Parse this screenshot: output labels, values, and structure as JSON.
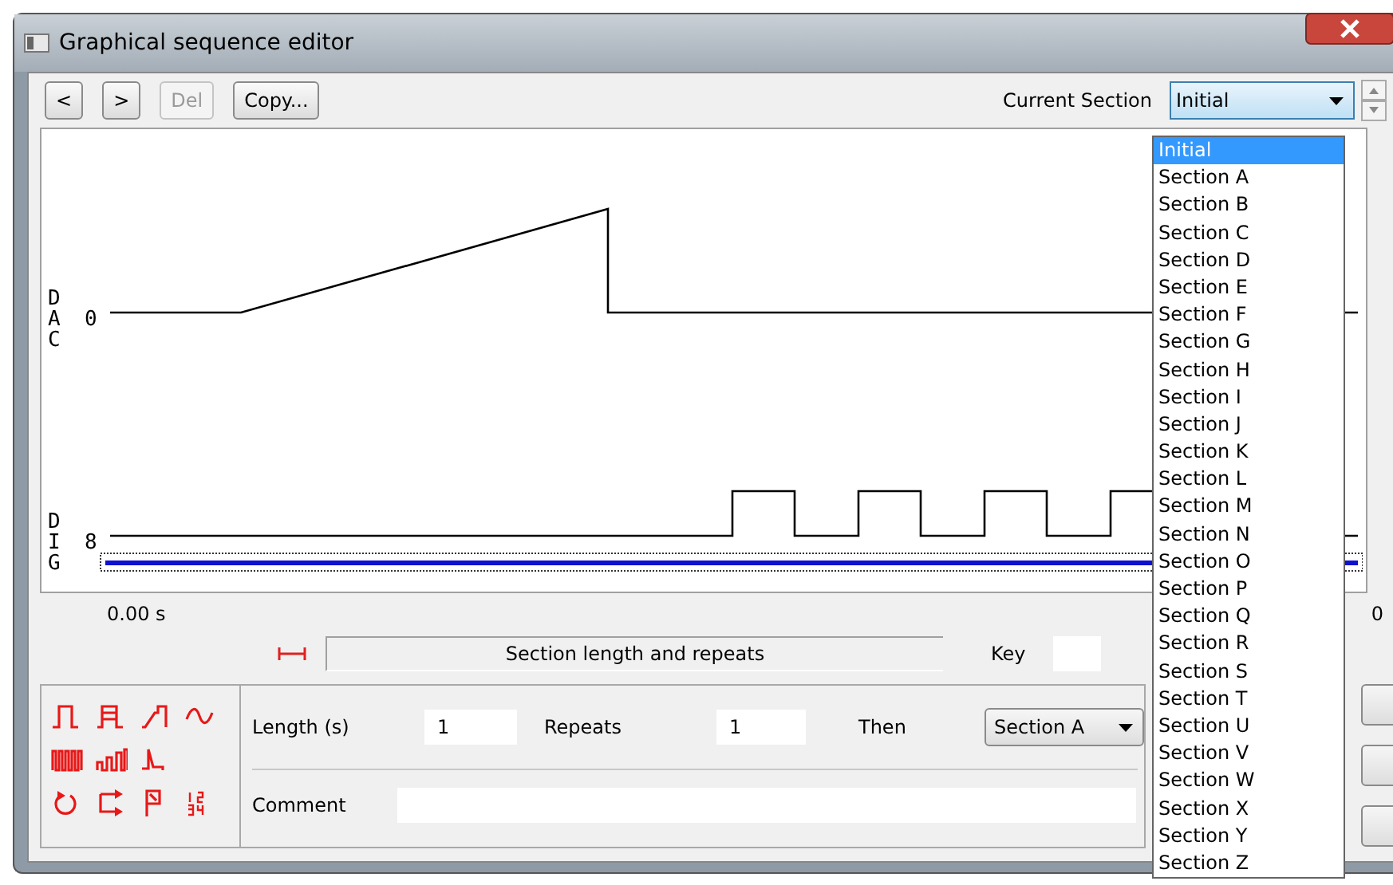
{
  "window": {
    "title": "Graphical sequence editor"
  },
  "toolbar": {
    "buttons": [
      {
        "label": "<",
        "disabled": false
      },
      {
        "label": ">",
        "disabled": false
      },
      {
        "label": "Del",
        "disabled": true
      },
      {
        "label": "Copy...",
        "disabled": false
      }
    ],
    "section_label": "Current Section",
    "section_value": "Initial"
  },
  "section_list": [
    {
      "label": "Initial",
      "selected": true
    },
    {
      "label": "Section A",
      "selected": false
    },
    {
      "label": "Section B",
      "selected": false
    },
    {
      "label": "Section C",
      "selected": false
    },
    {
      "label": "Section D",
      "selected": false
    },
    {
      "label": "Section E",
      "selected": false
    },
    {
      "label": "Section F",
      "selected": false
    },
    {
      "label": "Section G",
      "selected": false
    },
    {
      "label": "Section H",
      "selected": false
    },
    {
      "label": "Section I",
      "selected": false
    },
    {
      "label": "Section J",
      "selected": false
    },
    {
      "label": "Section K",
      "selected": false
    },
    {
      "label": "Section L",
      "selected": false
    },
    {
      "label": "Section M",
      "selected": false
    },
    {
      "label": "Section N",
      "selected": false
    },
    {
      "label": "Section O",
      "selected": false
    },
    {
      "label": "Section P",
      "selected": false
    },
    {
      "label": "Section Q",
      "selected": false
    },
    {
      "label": "Section R",
      "selected": false
    },
    {
      "label": "Section S",
      "selected": false
    },
    {
      "label": "Section T",
      "selected": false
    },
    {
      "label": "Section U",
      "selected": false
    },
    {
      "label": "Section V",
      "selected": false
    },
    {
      "label": "Section W",
      "selected": false
    },
    {
      "label": "Section X",
      "selected": false
    },
    {
      "label": "Section Y",
      "selected": false
    },
    {
      "label": "Section Z",
      "selected": false
    }
  ],
  "graph": {
    "rows": [
      {
        "kind": "dac",
        "label": "DAC",
        "value": "0"
      },
      {
        "kind": "dig",
        "label": "DIG",
        "value": "8"
      }
    ],
    "start_time": "0.00 s",
    "end_time": "0"
  },
  "section_header": {
    "title": "Section length and repeats",
    "key_label": "Key"
  },
  "properties": {
    "length_label": "Length (s)",
    "length": "1",
    "repeats_label": "Repeats",
    "repeats": "1",
    "then_label": "Then",
    "then": "Section A",
    "comment_label": "Comment"
  }
}
